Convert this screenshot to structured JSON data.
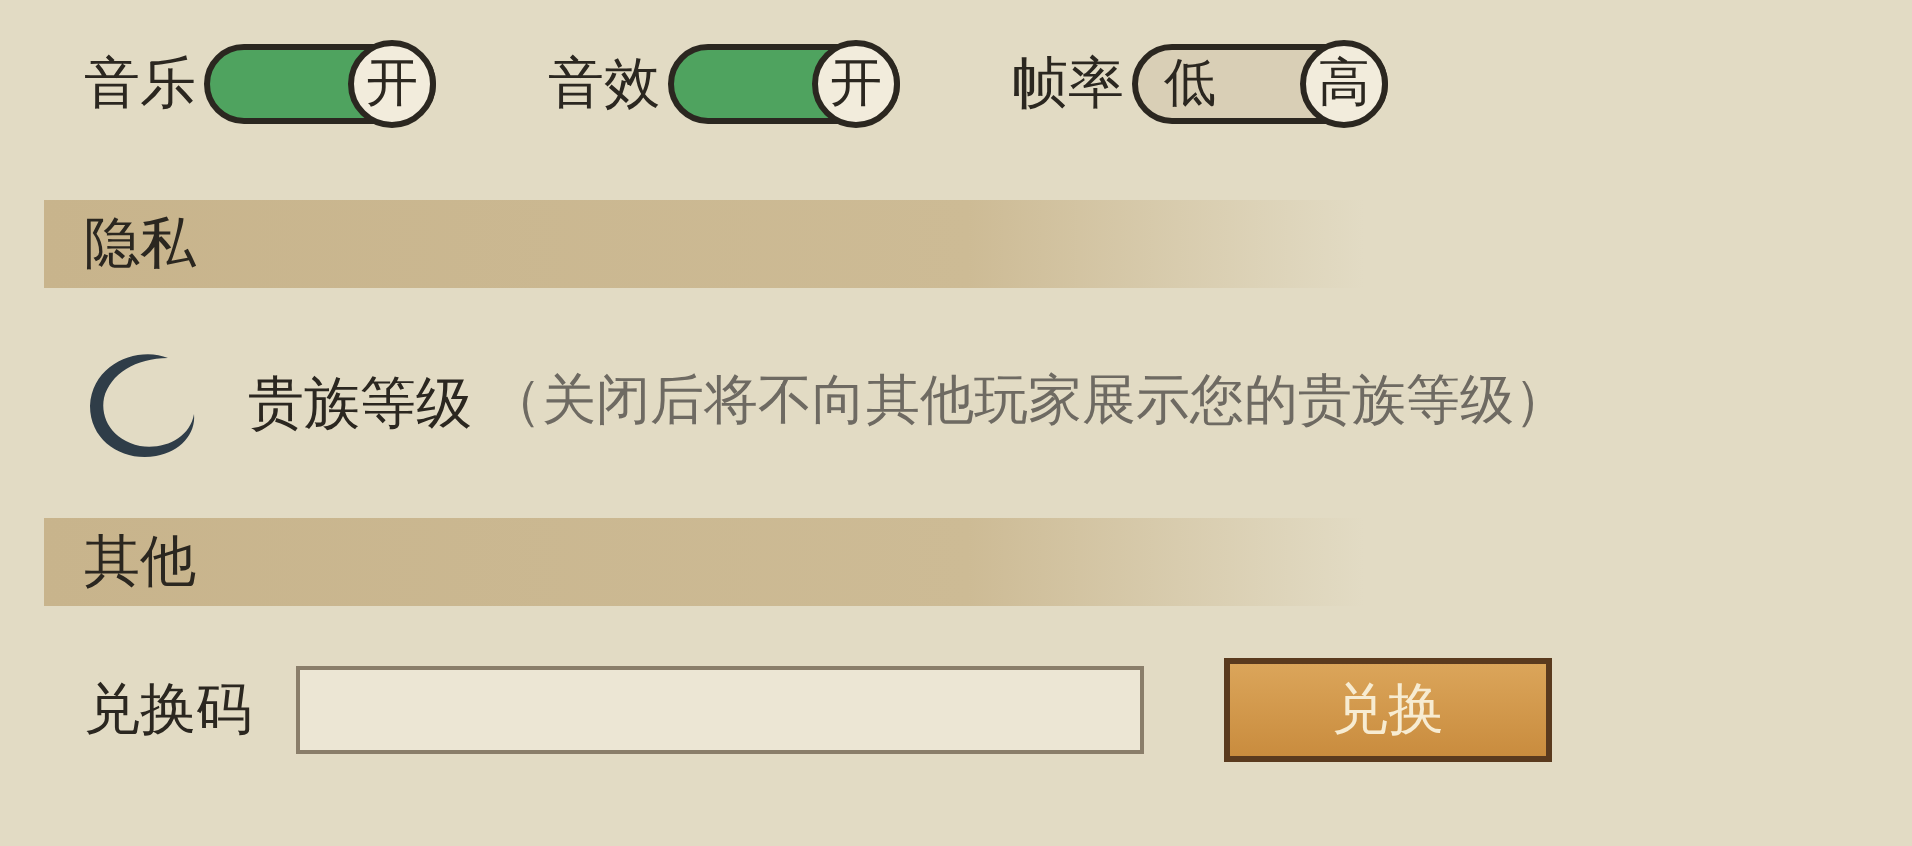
{
  "settings": [
    {
      "kind": "switch",
      "label": "音乐",
      "on": true,
      "thumb": "开"
    },
    {
      "kind": "switch",
      "label": "音效",
      "on": true,
      "thumb": "开"
    },
    {
      "kind": "choice",
      "label": "帧率",
      "options": [
        {
          "label": "低",
          "selected": false
        },
        {
          "label": "高",
          "selected": true
        }
      ]
    }
  ],
  "privacy": {
    "title": "隐私",
    "item": {
      "label": "贵族等级",
      "note": "（关闭后将不向其他玩家展示您的贵族等级）"
    }
  },
  "other": {
    "title": "其他",
    "redeem": {
      "label": "兑换码",
      "button": "兑换"
    }
  }
}
